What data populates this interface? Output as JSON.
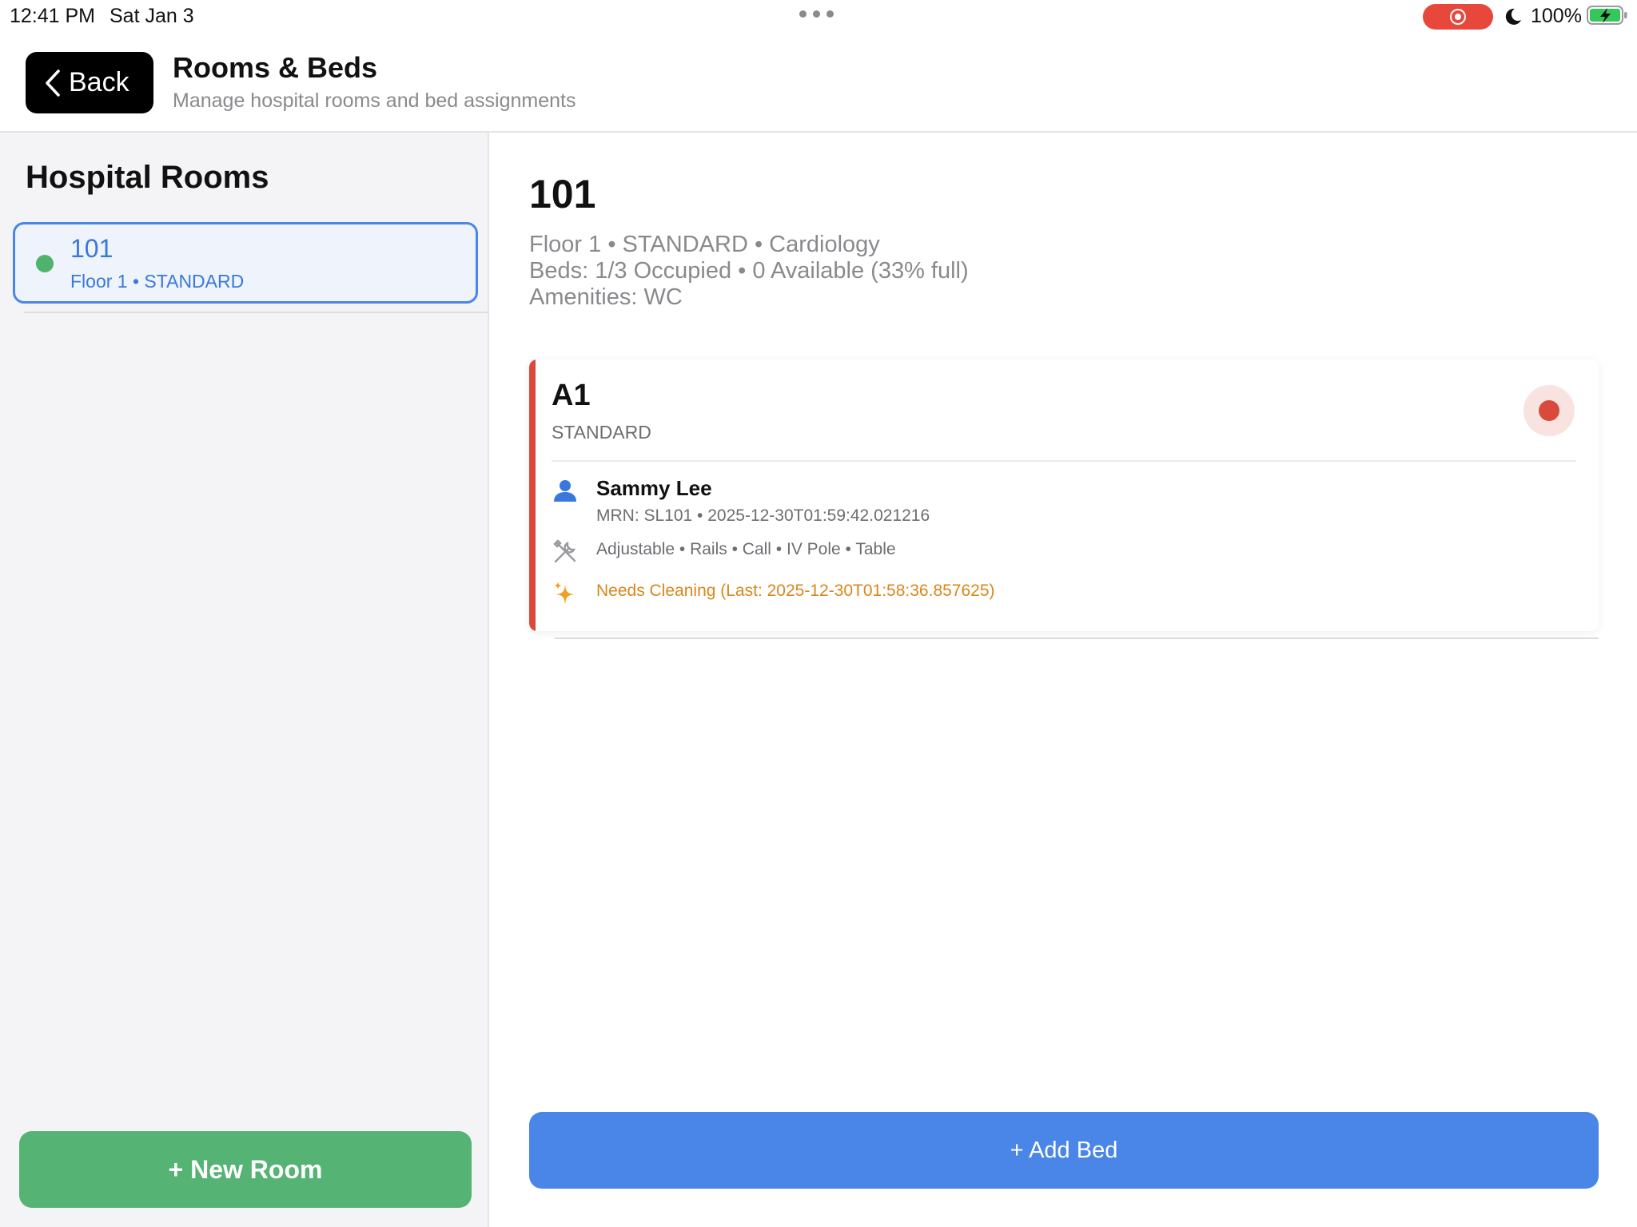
{
  "status_bar": {
    "time": "12:41 PM",
    "date": "Sat Jan 3",
    "battery": "100%",
    "record_color": "#e8473c",
    "battery_color": "#34c759"
  },
  "header": {
    "back_label": "Back",
    "title": "Rooms & Beds",
    "subtitle": "Manage hospital rooms and bed assignments"
  },
  "sidebar": {
    "title": "Hospital Rooms",
    "rooms": [
      {
        "number": "101",
        "meta": "Floor 1 • STANDARD",
        "status_color": "#4fb36e",
        "selected": true
      }
    ],
    "new_room_label": "+ New Room"
  },
  "detail": {
    "room_number": "101",
    "info_line": "Floor 1 • STANDARD • Cardiology",
    "beds_line": "Beds: 1/3 Occupied • 0 Available (33% full)",
    "amenities_line": "Amenities: WC",
    "beds": [
      {
        "name": "A1",
        "type": "STANDARD",
        "status_color": "#d94a3d",
        "patient_name": "Sammy Lee",
        "patient_mrn": "MRN: SL101 • 2025-12-30T01:59:42.021216",
        "features": "Adjustable • Rails • Call • IV Pole • Table",
        "cleaning": "Needs Cleaning (Last: 2025-12-30T01:58:36.857625)",
        "icons": [
          "person-icon",
          "tools-icon",
          "sparkles-icon"
        ]
      }
    ],
    "add_bed_label": "+ Add Bed"
  },
  "colors": {
    "accent_blue": "#4a86e8",
    "accent_green": "#55b374",
    "warning_orange": "#d9861a"
  }
}
